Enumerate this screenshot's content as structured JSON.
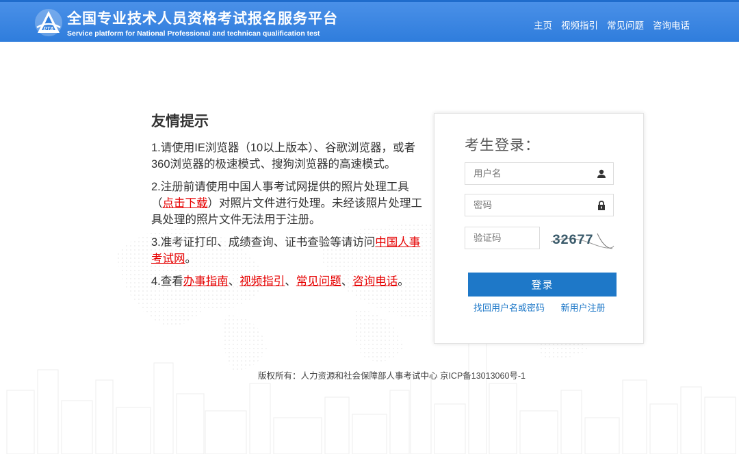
{
  "header": {
    "title_cn": "全国专业技术人员资格考试报名服务平台",
    "title_en": "Service platform for National Professional and technican qualification test",
    "logo_text": "PTA",
    "nav": [
      "主页",
      "视频指引",
      "常见问题",
      "咨询电话"
    ]
  },
  "tips": {
    "heading": "友情提示",
    "item1": "1.请使用IE浏览器（10以上版本）、谷歌浏览器，或者360浏览器的极速模式、搜狗浏览器的高速模式。",
    "item2_pre": "2.注册前请使用中国人事考试网提供的照片处理工具（",
    "item2_link": "点击下载",
    "item2_post": "）对照片文件进行处理。未经该照片处理工具处理的照片文件无法用于注册。",
    "item3_pre": "3.准考证打印、成绩查询、证书查验等请访问",
    "item3_link": "中国人事考试网",
    "item3_post": "。",
    "item4_pre": "4.查看",
    "item4_link1": "办事指南",
    "sep1": "、",
    "item4_link2": "视频指引",
    "sep2": "、",
    "item4_link3": "常见问题",
    "sep3": "、",
    "item4_link4": "咨询电话",
    "item4_post": "。"
  },
  "login": {
    "title": "考生登录：",
    "username_placeholder": "用户名",
    "password_placeholder": "密码",
    "captcha_placeholder": "验证码",
    "captcha_value": "32677",
    "submit_label": "登录",
    "forgot_link": "找回用户名或密码",
    "register_link": "新用户注册"
  },
  "footer": {
    "copyright": "版权所有：人力资源和社会保障部人事考试中心 京ICP备13013060号-1"
  },
  "colors": {
    "header_bg": "#3587e0",
    "primary_button": "#1e78c8",
    "link_red": "#e60000",
    "link_blue": "#1e78c8"
  }
}
